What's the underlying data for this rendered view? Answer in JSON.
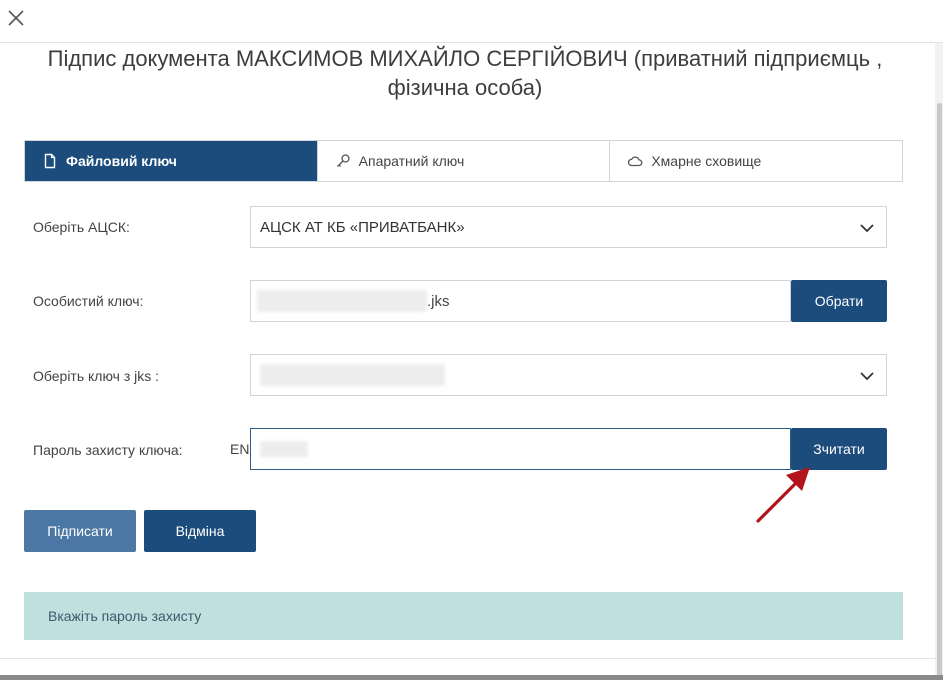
{
  "dialog": {
    "title": "Підпис документа МАКСИМОВ МИХАЙЛО СЕРГІЙОВИЧ (приватний підприємць , фізична особа)"
  },
  "tabs": [
    {
      "label": "Файловий ключ",
      "icon": "file-icon",
      "active": true
    },
    {
      "label": "Апаратний ключ",
      "icon": "key-icon",
      "active": false
    },
    {
      "label": "Хмарне сховище",
      "icon": "cloud-icon",
      "active": false
    }
  ],
  "form": {
    "acsk_label": "Оберіть АЦСК:",
    "acsk_value": "АЦСК АТ КБ «ПРИВАТБАНК»",
    "private_key_label": "Особистий ключ:",
    "private_key_suffix": ".jks",
    "choose_button": "Обрати",
    "jks_key_label": "Оберіть ключ з jks :",
    "password_label": "Пароль захисту ключа:",
    "lang_indicator": "EN",
    "read_button": "Зчитати"
  },
  "actions": {
    "sign_button": "Підписати",
    "cancel_button": "Відміна"
  },
  "alert": {
    "message": "Вкажіть пароль захисту"
  },
  "colors": {
    "primary": "#1c4c7c",
    "primary_light": "#4a77a3",
    "alert_bg": "#bfe0df",
    "arrow": "#b3141b"
  }
}
